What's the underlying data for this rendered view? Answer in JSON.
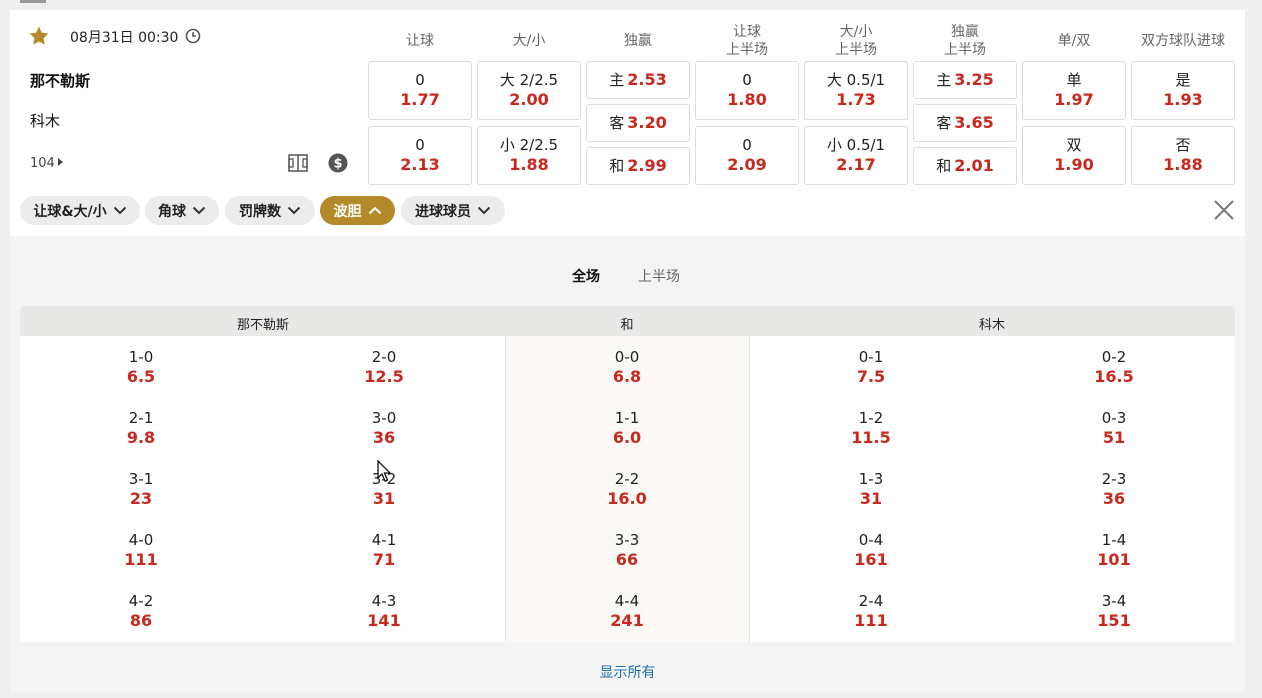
{
  "match": {
    "datetime": "08月31日 00:30",
    "home_team": "那不勒斯",
    "away_team": "科木",
    "more_markets_count": "104"
  },
  "markets": [
    {
      "header": "让球",
      "rows": [
        {
          "label": "0",
          "odds": "1.77"
        },
        {
          "label": "0",
          "odds": "2.13"
        }
      ]
    },
    {
      "header": "大/小",
      "rows": [
        {
          "label": "大 2/2.5",
          "odds": "2.00"
        },
        {
          "label": "小 2/2.5",
          "odds": "1.88"
        }
      ]
    },
    {
      "header": "独赢",
      "rows": [
        {
          "label": "主",
          "odds": "2.53"
        },
        {
          "label": "客",
          "odds": "3.20"
        },
        {
          "label": "和",
          "odds": "2.99"
        }
      ]
    },
    {
      "header": "让球\n上半场",
      "rows": [
        {
          "label": "0",
          "odds": "1.80"
        },
        {
          "label": "0",
          "odds": "2.09"
        }
      ]
    },
    {
      "header": "大/小\n上半场",
      "rows": [
        {
          "label": "大 0.5/1",
          "odds": "1.73"
        },
        {
          "label": "小 0.5/1",
          "odds": "2.17"
        }
      ]
    },
    {
      "header": "独赢\n上半场",
      "rows": [
        {
          "label": "主",
          "odds": "3.25"
        },
        {
          "label": "客",
          "odds": "3.65"
        },
        {
          "label": "和",
          "odds": "2.01"
        }
      ]
    },
    {
      "header": "单/双",
      "rows": [
        {
          "label": "单",
          "odds": "1.97"
        },
        {
          "label": "双",
          "odds": "1.90"
        }
      ]
    },
    {
      "header": "双方球队进球",
      "rows": [
        {
          "label": "是",
          "odds": "1.93"
        },
        {
          "label": "否",
          "odds": "1.88"
        }
      ]
    }
  ],
  "filters": [
    {
      "label": "让球&大/小",
      "active": false
    },
    {
      "label": "角球",
      "active": false
    },
    {
      "label": "罚牌数",
      "active": false
    },
    {
      "label": "波胆",
      "active": true
    },
    {
      "label": "进球球员",
      "active": false
    }
  ],
  "periods": {
    "full": "全场",
    "half": "上半场"
  },
  "correct_score": {
    "headers": {
      "home": "那不勒斯",
      "draw": "和",
      "away": "科木"
    },
    "columns": [
      [
        {
          "score": "1-0",
          "odds": "6.5"
        },
        {
          "score": "2-1",
          "odds": "9.8"
        },
        {
          "score": "3-1",
          "odds": "23"
        },
        {
          "score": "4-0",
          "odds": "111"
        },
        {
          "score": "4-2",
          "odds": "86"
        }
      ],
      [
        {
          "score": "2-0",
          "odds": "12.5"
        },
        {
          "score": "3-0",
          "odds": "36"
        },
        {
          "score": "3-2",
          "odds": "31"
        },
        {
          "score": "4-1",
          "odds": "71"
        },
        {
          "score": "4-3",
          "odds": "141"
        }
      ],
      [
        {
          "score": "0-0",
          "odds": "6.8"
        },
        {
          "score": "1-1",
          "odds": "6.0"
        },
        {
          "score": "2-2",
          "odds": "16.0"
        },
        {
          "score": "3-3",
          "odds": "66"
        },
        {
          "score": "4-4",
          "odds": "241"
        }
      ],
      [
        {
          "score": "0-1",
          "odds": "7.5"
        },
        {
          "score": "1-2",
          "odds": "11.5"
        },
        {
          "score": "1-3",
          "odds": "31"
        },
        {
          "score": "0-4",
          "odds": "161"
        },
        {
          "score": "2-4",
          "odds": "111"
        }
      ],
      [
        {
          "score": "0-2",
          "odds": "16.5"
        },
        {
          "score": "0-3",
          "odds": "51"
        },
        {
          "score": "2-3",
          "odds": "36"
        },
        {
          "score": "1-4",
          "odds": "101"
        },
        {
          "score": "3-4",
          "odds": "151"
        }
      ]
    ]
  },
  "show_all_label": "显示所有",
  "colors": {
    "accent": "#b3892a",
    "odds": "#c8281e",
    "link": "#1f6fb5"
  }
}
